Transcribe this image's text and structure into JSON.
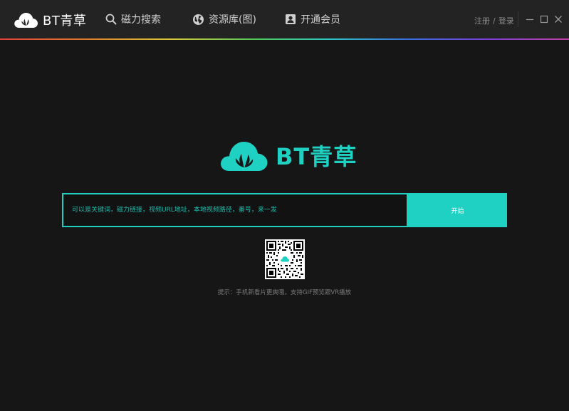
{
  "app": {
    "brand_name": "BT青草",
    "logo_color": "#1fd1c2"
  },
  "nav": {
    "items": [
      {
        "label": "磁力搜索",
        "icon": "search-icon"
      },
      {
        "label": "资源库(图)",
        "icon": "globe-icon"
      },
      {
        "label": "开通会员",
        "icon": "member-card-icon"
      }
    ]
  },
  "auth": {
    "register": "注册",
    "separator": "/",
    "login": "登录"
  },
  "window_controls": [
    "minimize-icon",
    "maximize-icon",
    "close-icon"
  ],
  "main": {
    "hero_name": "BT青草",
    "search": {
      "value": "",
      "placeholder": "可以是关键词，磁力链接，视频URL地址，本地视频路径，番号，来一发"
    },
    "start_button": "开始",
    "qr_icon": "qr-code-icon",
    "tip": "提示：手机新看片更爽哦，支持GIF预览跟VR播放"
  },
  "colors": {
    "accent": "#1fd1c2",
    "background": "#161616",
    "titlebar": "#232323"
  }
}
